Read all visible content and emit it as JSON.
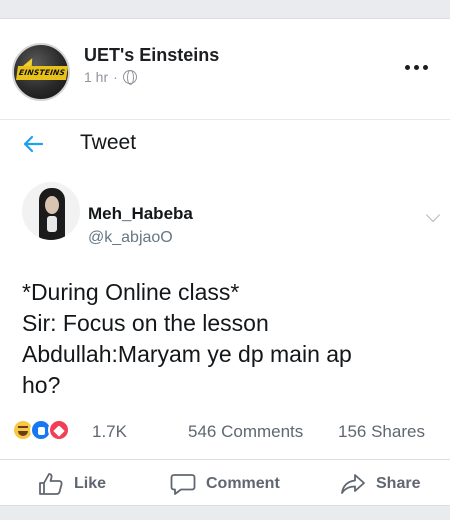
{
  "post": {
    "page_name": "UET's Einsteins",
    "logo_text": "EINSTEINS",
    "time": "1 hr",
    "separator": "·"
  },
  "tweet": {
    "header_title": "Tweet",
    "user_name": "Meh_Habeba",
    "user_handle": "@k_abjaoO",
    "text_lines": [
      "*During Online class*",
      "Sir: Focus on the lesson",
      "Abdullah:Maryam ye dp main ap",
      "ho?"
    ]
  },
  "stats": {
    "reactions_count": "1.7K",
    "comments": "546 Comments",
    "shares": "156 Shares"
  },
  "actions": {
    "like": "Like",
    "comment": "Comment",
    "share": "Share"
  },
  "icons": {
    "accent": "#1da1f2",
    "reaction_types": [
      "haha",
      "like",
      "love"
    ]
  }
}
